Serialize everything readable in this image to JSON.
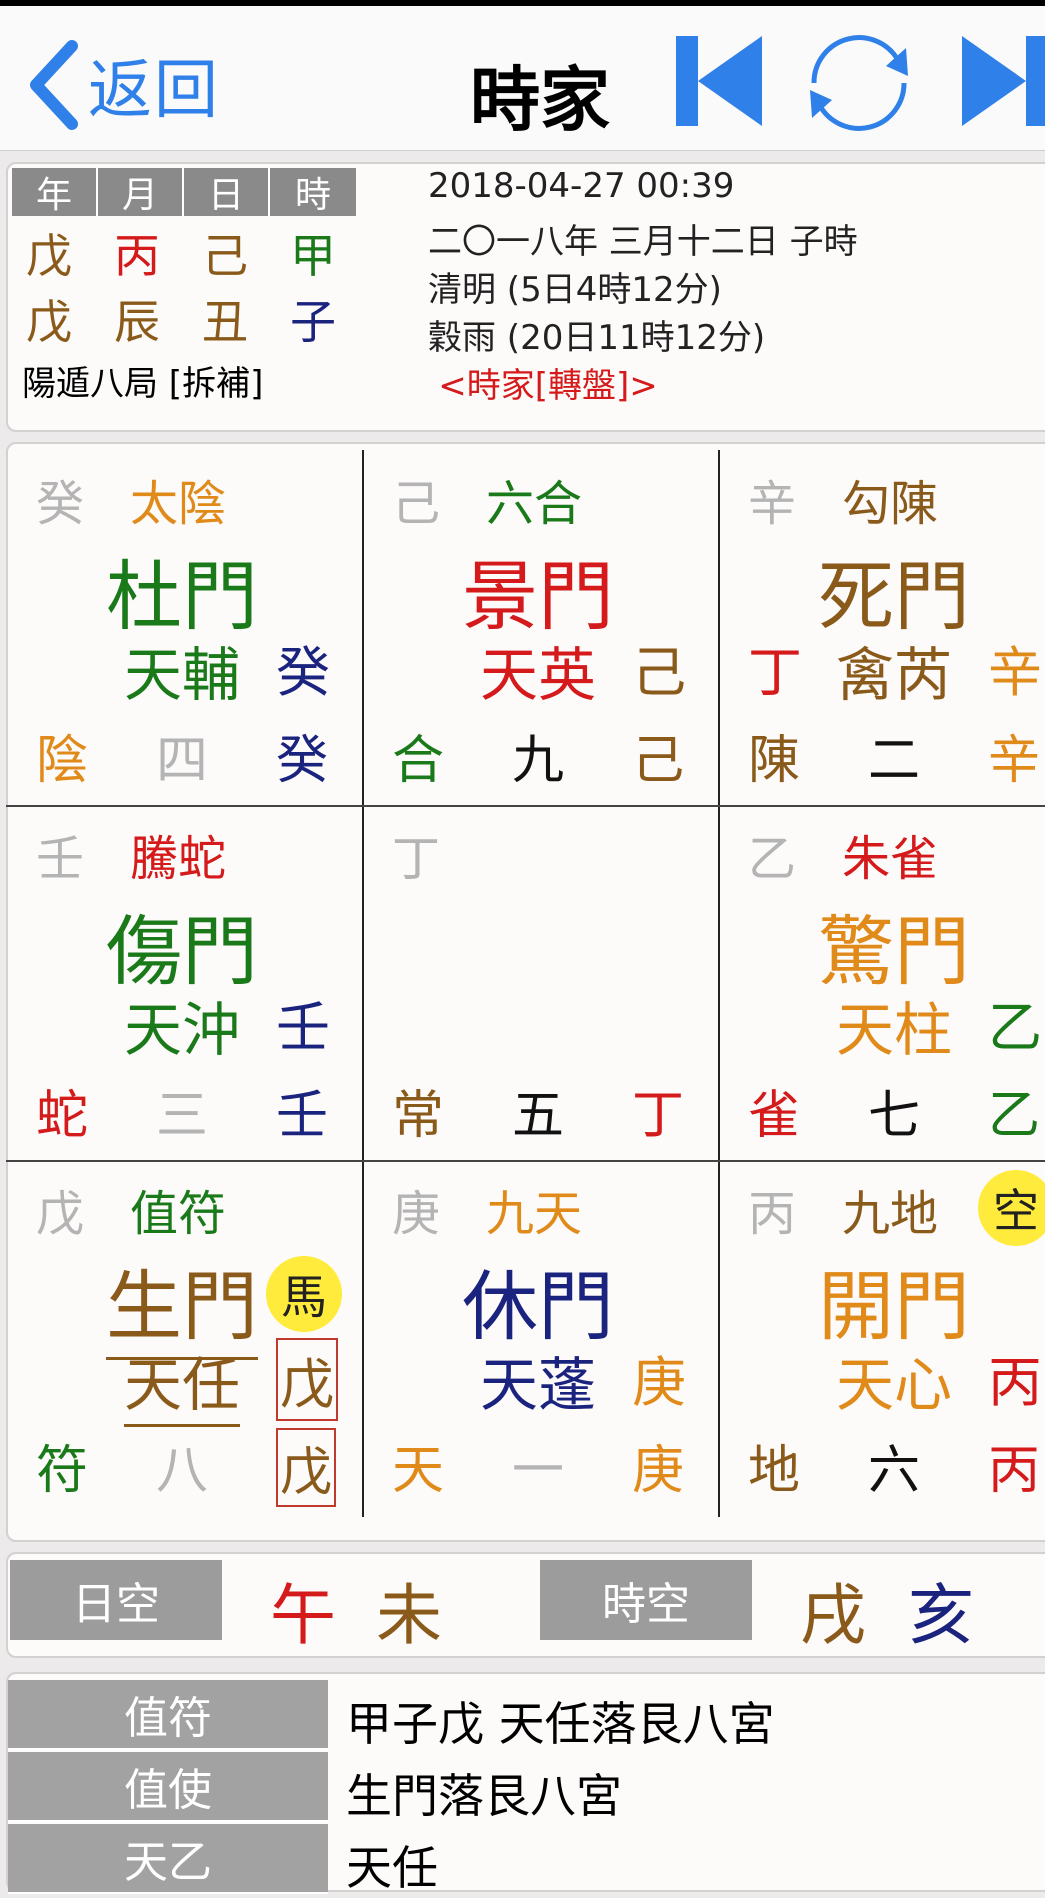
{
  "nav": {
    "back_label": "返回",
    "title": "時家"
  },
  "info": {
    "headers": [
      "年",
      "月",
      "日",
      "時"
    ],
    "stems": [
      "戊",
      "丙",
      "己",
      "甲"
    ],
    "branches": [
      "戊",
      "辰",
      "丑",
      "子"
    ],
    "ju": "陽遁八局 [拆補]",
    "solar_datetime": "2018-04-27 00:39",
    "lunar_date": "二〇一八年 三月十二日 子時",
    "term1": "清明 (5日4時12分)",
    "term2": "穀雨 (20日11時12分)",
    "mode": "<時家[轉盤]>"
  },
  "palaces": [
    {
      "tl": "癸",
      "god": "太陰",
      "door": "杜門",
      "star": "天輔",
      "star_stem": "癸",
      "bl": "陰",
      "num": "四",
      "br": "癸"
    },
    {
      "tl": "己",
      "god": "六合",
      "door": "景門",
      "star": "天英",
      "star_stem": "己",
      "bl": "合",
      "num": "九",
      "br": "己"
    },
    {
      "tl": "辛",
      "god": "勾陳",
      "door": "死門",
      "star_left": "丁",
      "star": "禽芮",
      "star_stem": "辛",
      "bl": "陳",
      "num": "二",
      "br": "辛"
    },
    {
      "tl": "壬",
      "god": "騰蛇",
      "door": "傷門",
      "star": "天沖",
      "star_stem": "壬",
      "bl": "蛇",
      "num": "三",
      "br": "壬"
    },
    {
      "tl": "丁",
      "bl": "常",
      "num": "五",
      "br": "丁"
    },
    {
      "tl": "乙",
      "god": "朱雀",
      "door": "驚門",
      "star": "天柱",
      "star_stem": "乙",
      "bl": "雀",
      "num": "七",
      "br": "乙"
    },
    {
      "tl": "戊",
      "god": "值符",
      "door": "生門",
      "badge": "馬",
      "star": "天任",
      "star_stem": "戊",
      "bl": "符",
      "num": "八",
      "br": "戊"
    },
    {
      "tl": "庚",
      "god": "九天",
      "door": "休門",
      "star": "天蓬",
      "star_stem": "庚",
      "bl": "天",
      "num": "一",
      "br": "庚"
    },
    {
      "tl": "丙",
      "god": "九地",
      "badge": "空",
      "door": "開門",
      "star": "天心",
      "star_stem": "丙",
      "bl": "地",
      "num": "六",
      "br": "丙"
    }
  ],
  "kong": {
    "day_label": "日空",
    "day_values": [
      "午",
      "未"
    ],
    "hour_label": "時空",
    "hour_values": [
      "戌",
      "亥"
    ]
  },
  "table": [
    {
      "label": "值符",
      "value": "甲子戊  天任落艮八宮"
    },
    {
      "label": "值使",
      "value": "生門落艮八宮"
    },
    {
      "label": "天乙",
      "value": "天任"
    }
  ],
  "colors": {
    "accent_blue": "#2f80e8",
    "green": "#1a7a1a",
    "red": "#d41a1a",
    "orange": "#e08a1a",
    "brown": "#8a5a1a",
    "navy": "#1a237e",
    "gray": "#b4b4b4"
  }
}
